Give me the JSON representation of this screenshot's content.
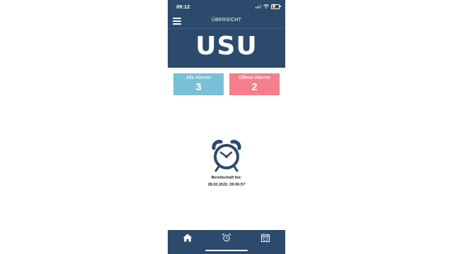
{
  "status_bar": {
    "time": "09:12",
    "battery_color": "#f4d03f",
    "battery_level": 0.55
  },
  "nav": {
    "title": "ÜBERSICHT",
    "menu_icon": "hamburger-menu-icon"
  },
  "logo": {
    "text": "USU"
  },
  "cards": {
    "all_alarms": {
      "label": "Alle Alarme",
      "count": "3",
      "color": "#79bfd6"
    },
    "open_alarms": {
      "label": "Offene Alarme",
      "count": "2",
      "color": "#f47f8b"
    }
  },
  "standby": {
    "icon": "alarm-clock-icon",
    "label": "Bereitschaft bis:",
    "value": "28.02.2022, 09:06:57"
  },
  "tabbar": {
    "items": [
      {
        "icon": "home-icon",
        "active": true
      },
      {
        "icon": "alarm-clock-icon",
        "active": false
      },
      {
        "icon": "calendar-icon",
        "active": false
      }
    ]
  },
  "colors": {
    "primary": "#2c4a6b",
    "background": "#ffffff"
  }
}
